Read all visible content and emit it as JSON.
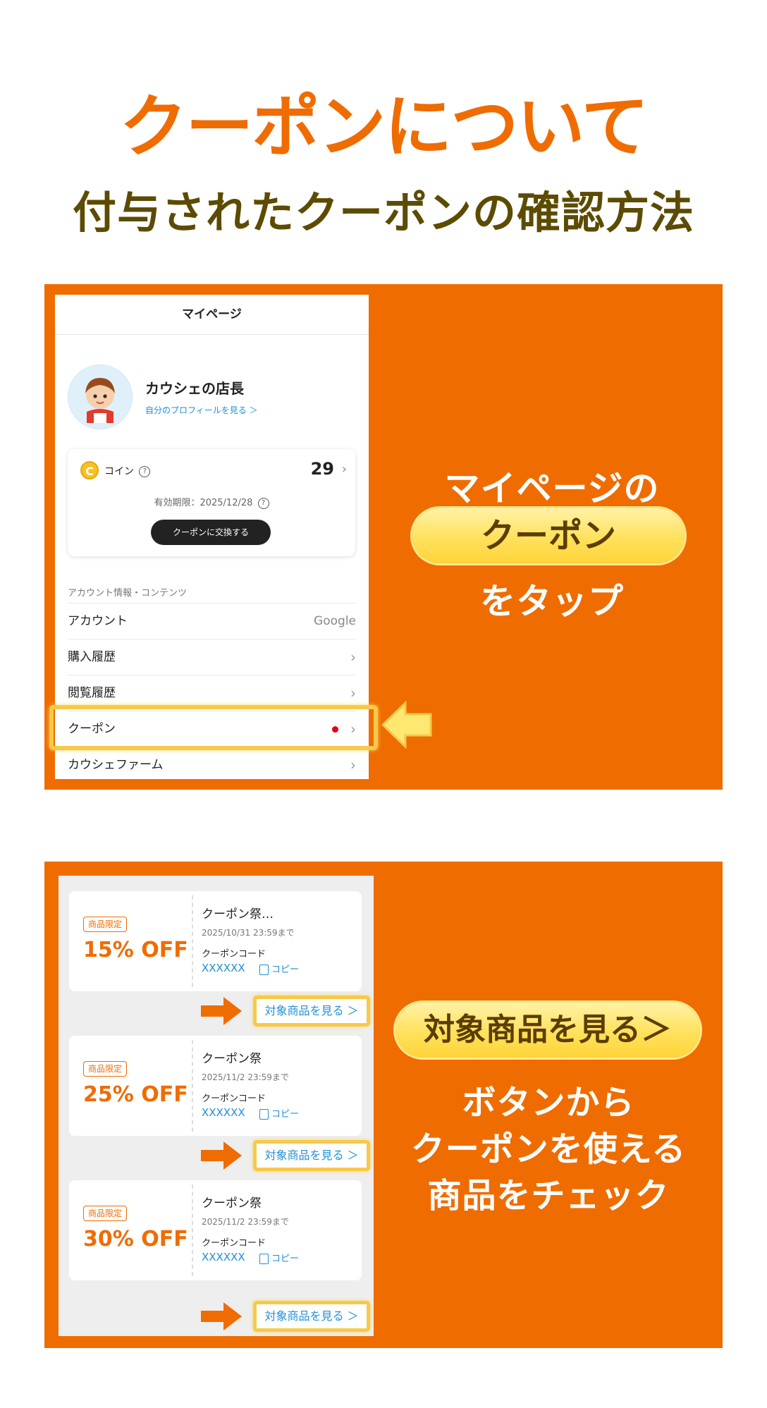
{
  "page": {
    "headline": "クーポンについて",
    "subtitle": "付与されたクーポンの確認方法"
  },
  "colors": {
    "accent_orange": "#ef6c00",
    "subtitle_brown": "#5c4b00",
    "highlight_yellow": "#f6c94a",
    "link_blue": "#1f8fd6",
    "notification_red": "#e60012"
  },
  "mypage": {
    "header_title": "マイページ",
    "user_name": "カウシェの店長",
    "profile_link": "自分のプロフィールを見る ＞",
    "coin_label": "コイン",
    "coin_value": "29",
    "coin_expiry": "有効期限：2025/12/28",
    "exchange_button": "クーポンに交換する",
    "section_label": "アカウント情報・コンテンツ",
    "menu": [
      {
        "label": "アカウント",
        "value": "Google"
      },
      {
        "label": "購入履歴"
      },
      {
        "label": "閲覧履歴"
      },
      {
        "label": "クーポン",
        "has_notification": true
      },
      {
        "label": "カウシェファーム"
      }
    ]
  },
  "instruction1": {
    "line1": "マイページの",
    "pill": "クーポン",
    "line2": "をタップ"
  },
  "coupons": [
    {
      "badge": "商品限定",
      "discount": "15% OFF",
      "title": "クーポン祭…",
      "date": "2025/10/31 23:59まで",
      "code_label": "クーポンコード",
      "code": "XXXXXX",
      "copy_label": "コピー",
      "target_button": "対象商品を見る ＞"
    },
    {
      "badge": "商品限定",
      "discount": "25% OFF",
      "title": "クーポン祭",
      "date": "2025/11/2 23:59まで",
      "code_label": "クーポンコード",
      "code": "XXXXXX",
      "copy_label": "コピー",
      "target_button": "対象商品を見る ＞"
    },
    {
      "badge": "商品限定",
      "discount": "30% OFF",
      "title": "クーポン祭",
      "date": "2025/11/2 23:59まで",
      "code_label": "クーポンコード",
      "code": "XXXXXX",
      "copy_label": "コピー",
      "target_button": "対象商品を見る ＞"
    }
  ],
  "instruction2": {
    "pill": "対象商品を見る＞",
    "line1": "ボタンから",
    "line2": "クーポンを使える",
    "line3": "商品をチェック"
  }
}
